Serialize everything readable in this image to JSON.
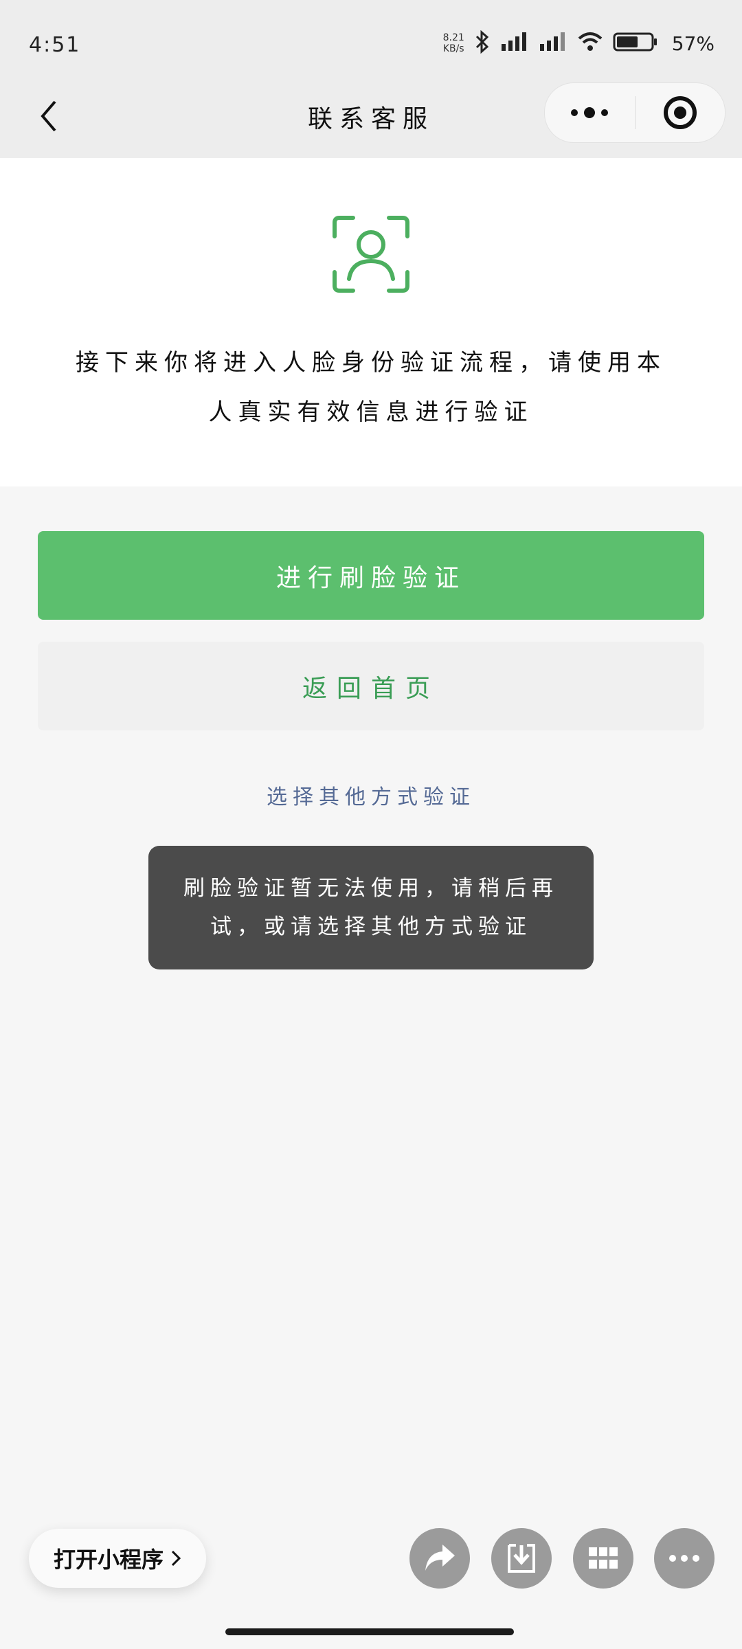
{
  "status_bar": {
    "time": "4:51",
    "net_speed_value": "8.21",
    "net_speed_unit": "KB/s",
    "battery_percent": "57%"
  },
  "nav": {
    "title": "联系客服"
  },
  "intro": {
    "line1": "接下来你将进入人脸身份验证流程，请使用本",
    "line2": "人真实有效信息进行验证"
  },
  "actions": {
    "primary_label": "进行刷脸验证",
    "secondary_label": "返回首页",
    "other_method_label": "选择其他方式验证"
  },
  "toast": {
    "line1": "刷脸验证暂无法使用，请稍后再",
    "line2": "试，或请选择其他方式验证"
  },
  "bottom_bar": {
    "open_mini_program_label": "打开小程序"
  },
  "icons": {
    "back": "chevron-left-icon",
    "more": "more-dots-icon",
    "close": "target-icon",
    "face": "face-scan-icon",
    "share": "share-arrow-icon",
    "download": "download-icon",
    "grid": "grid-icon",
    "overflow": "ellipsis-icon"
  },
  "colors": {
    "accent_green": "#5cbf6e",
    "secondary_green_text": "#3a9d55",
    "link_blue": "#556a95",
    "toast_bg": "#4b4b4b"
  }
}
